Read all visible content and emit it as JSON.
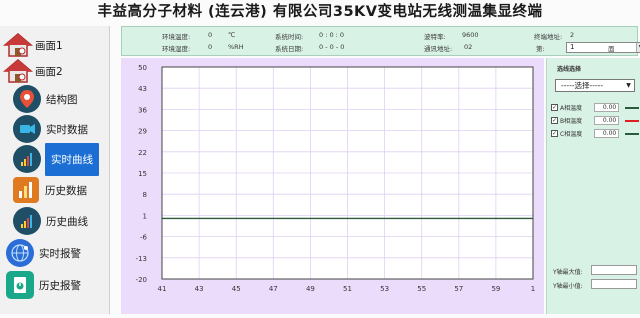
{
  "title": "丰益高分子材料 (连云港) 有限公司35KV变电站无线测温集显终端",
  "sidebar": {
    "items": [
      {
        "label": "画面1",
        "icon": "house-icon"
      },
      {
        "label": "画面2",
        "icon": "house-icon"
      },
      {
        "label": "结构图",
        "icon": "location-pin-icon"
      },
      {
        "label": "实时数据",
        "icon": "video-camera-icon"
      },
      {
        "label": "实时曲线",
        "icon": "signal-chart-icon"
      },
      {
        "label": "历史数据",
        "icon": "bar-chart-icon"
      },
      {
        "label": "历史曲线",
        "icon": "signal-chart-icon"
      },
      {
        "label": "实时报警",
        "icon": "globe-network-icon"
      },
      {
        "label": "历史报警",
        "icon": "file-alarm-icon"
      }
    ],
    "active_index": 4
  },
  "status": {
    "env_temp_label": "环境温度:",
    "env_temp_value": "0",
    "env_temp_unit": "℃",
    "env_hum_label": "环境湿度:",
    "env_hum_value": "0",
    "env_hum_unit": "%RH",
    "sys_time_label": "系统时间:",
    "sys_time_value": "0  :  0  :  0",
    "sys_date_label": "系统日期:",
    "sys_date_value": "0  -  0  -  0",
    "baud_label": "波特率:",
    "baud_value": "9600",
    "comm_addr_label": "通讯地址:",
    "comm_addr_value": "02",
    "terminal_addr_label": "终端地址:",
    "terminal_addr_value": "2",
    "page_label": "第:",
    "page_value": "1",
    "page_suffix": "面"
  },
  "right_panel": {
    "header": "选线选择",
    "dropdown_value": "-----选择-----",
    "series": [
      {
        "label": "A相温度",
        "value": "0.00",
        "color": "#2d5a3a",
        "checked": true
      },
      {
        "label": "B相温度",
        "value": "0.00",
        "color": "#e02020",
        "checked": true
      },
      {
        "label": "C相温度",
        "value": "0.00",
        "color": "#2d5a3a",
        "checked": true
      }
    ],
    "y_max_label": "Y轴最大值:",
    "y_min_label": "Y轴最小值:"
  },
  "chart_data": {
    "type": "line",
    "x": [
      41,
      43,
      45,
      47,
      49,
      51,
      53,
      55,
      57,
      59,
      1
    ],
    "ylim": [
      -20,
      50
    ],
    "yticks": [
      50,
      43,
      36,
      29,
      22,
      15,
      8,
      1,
      -6,
      -13,
      -20
    ],
    "series": [
      {
        "values": [
          0,
          0,
          0,
          0,
          0,
          0,
          0,
          0,
          0,
          0,
          0
        ],
        "color": "#2d5a3a"
      }
    ],
    "grid": true,
    "plot_bg": "#ffffff",
    "grid_color": "#dfd0f2"
  }
}
